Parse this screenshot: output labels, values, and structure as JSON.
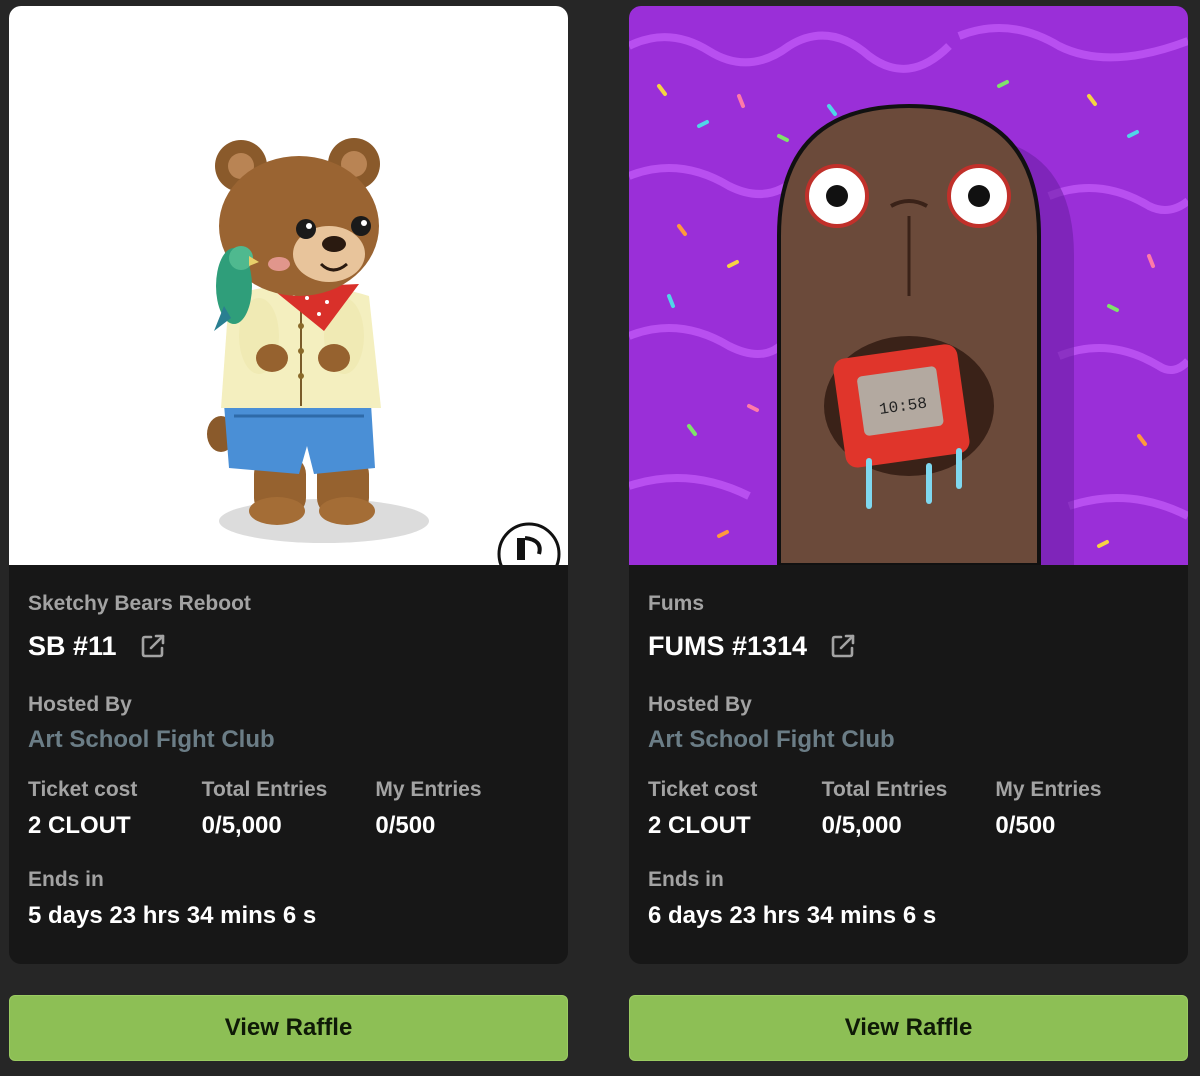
{
  "cards": [
    {
      "collection": "Sketchy Bears Reboot",
      "title": "SB #11",
      "hosted_by_label": "Hosted By",
      "host": "Art School Fight Club",
      "ticket_cost_label": "Ticket cost",
      "ticket_cost": "2 CLOUT",
      "total_entries_label": "Total Entries",
      "total_entries": "0/5,000",
      "my_entries_label": "My Entries",
      "my_entries": "0/500",
      "ends_label": "Ends in",
      "ends_value": "5 days 23 hrs 34 mins 6 s",
      "button_label": "View Raffle",
      "art_background": "#ffffff"
    },
    {
      "collection": "Fums",
      "title": "FUMS #1314",
      "hosted_by_label": "Hosted By",
      "host": "Art School Fight Club",
      "ticket_cost_label": "Ticket cost",
      "ticket_cost": "2 CLOUT",
      "total_entries_label": "Total Entries",
      "total_entries": "0/5,000",
      "my_entries_label": "My Entries",
      "my_entries": "0/500",
      "ends_label": "Ends in",
      "ends_value": "6 days 23 hrs 34 mins 6 s",
      "button_label": "View Raffle",
      "art_background": "#9a2fd8"
    }
  ],
  "icons": {
    "external_link": "external-link-icon"
  },
  "colors": {
    "page_background": "#262626",
    "card_background": "#171717",
    "button_green": "#8dbf55",
    "host_link": "#6b7d86"
  }
}
